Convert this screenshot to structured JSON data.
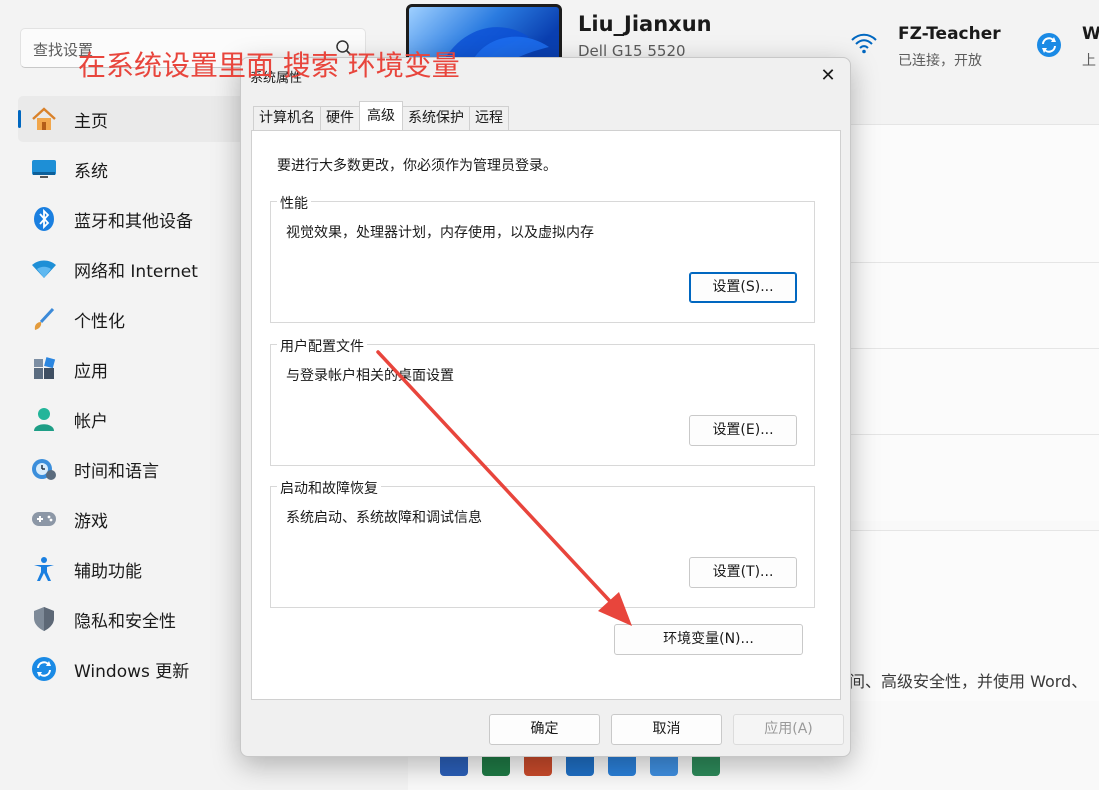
{
  "search": {
    "placeholder": "查找设置"
  },
  "annotation": {
    "text": "在系统设置里面 搜索  环境变量",
    "color": "#e8453c"
  },
  "nav": {
    "items": [
      {
        "label": "主页",
        "icon": "home-icon",
        "active": true
      },
      {
        "label": "系统",
        "icon": "monitor-icon"
      },
      {
        "label": "蓝牙和其他设备",
        "icon": "bluetooth-icon"
      },
      {
        "label": "网络和 Internet",
        "icon": "wifi-icon"
      },
      {
        "label": "个性化",
        "icon": "brush-icon"
      },
      {
        "label": "应用",
        "icon": "apps-icon"
      },
      {
        "label": "帐户",
        "icon": "account-icon"
      },
      {
        "label": "时间和语言",
        "icon": "clock-globe-icon"
      },
      {
        "label": "游戏",
        "icon": "gamepad-icon"
      },
      {
        "label": "辅助功能",
        "icon": "accessibility-icon"
      },
      {
        "label": "隐私和安全性",
        "icon": "shield-icon"
      },
      {
        "label": "Windows 更新",
        "icon": "update-icon"
      }
    ]
  },
  "profile": {
    "name": "Liu_Jianxun",
    "device": "Dell G15 5520"
  },
  "network": {
    "name": "FZ-Teacher",
    "status": "已连接，开放"
  },
  "update": {
    "label": "W",
    "sub": "上"
  },
  "main": {
    "office_text": "间、高级安全性，并使用 Word、"
  },
  "dialog": {
    "title": "系统属性",
    "close_glyph": "✕",
    "tabs": [
      "计算机名",
      "硬件",
      "高级",
      "系统保护",
      "远程"
    ],
    "active_tab": "高级",
    "admin_note": "要进行大多数更改，你必须作为管理员登录。",
    "groups": [
      {
        "title": "性能",
        "desc": "视觉效果，处理器计划，内存使用，以及虚拟内存",
        "button": "设置(S)..."
      },
      {
        "title": "用户配置文件",
        "desc": "与登录帐户相关的桌面设置",
        "button": "设置(E)..."
      },
      {
        "title": "启动和故障恢复",
        "desc": "系统启动、系统故障和调试信息",
        "button": "设置(T)..."
      }
    ],
    "env_button": "环境变量(N)...",
    "ok": "确定",
    "cancel": "取消",
    "apply": "应用(A)"
  },
  "colors": {
    "accent": "#0067c0",
    "arrow": "#e8453c"
  }
}
